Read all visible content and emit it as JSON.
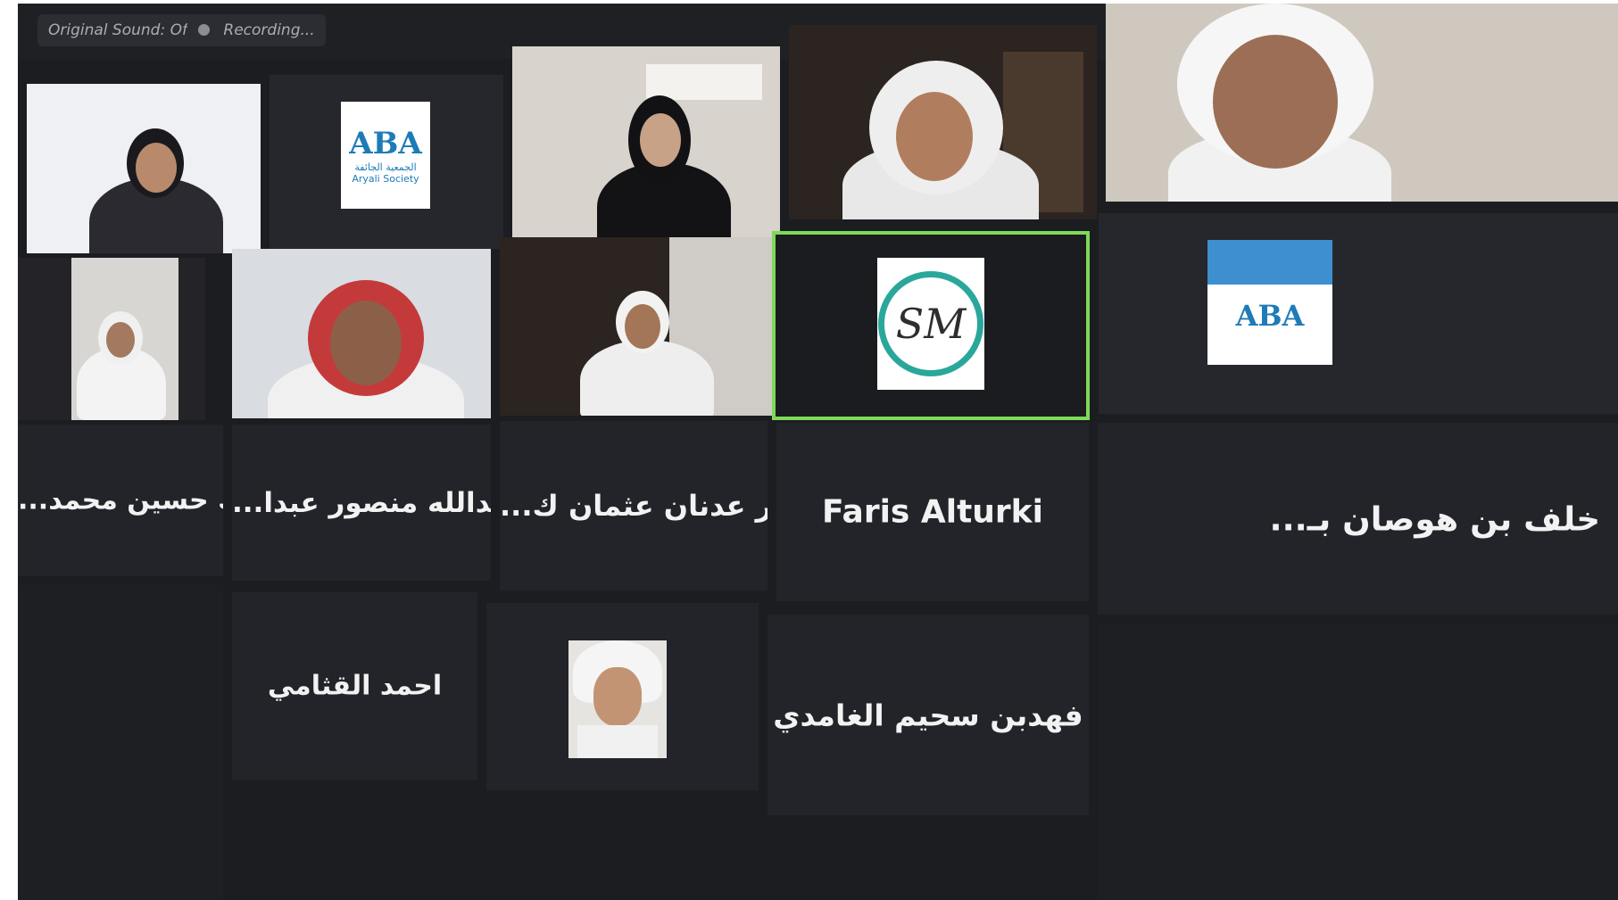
{
  "toolbar": {
    "audio_label": "Original Sound: Off",
    "recording_label": "Recording..."
  },
  "participants": {
    "p1": {
      "name": ""
    },
    "p2": {
      "name": ""
    },
    "p3": {
      "name": ""
    },
    "p4": {
      "name": ""
    },
    "p5": {
      "name": ""
    },
    "p6": {
      "name": ""
    },
    "p7": {
      "name": ""
    },
    "p8": {
      "name": ""
    },
    "p9": {
      "name": "Faris Alturki"
    },
    "p10": {
      "name": ""
    }
  },
  "name_tiles": {
    "t1": "...مبارك حسين محمد",
    "t2": "...عبدالله منصور عبدا",
    "t3": "...بندر عدنان عثمان ك",
    "t4": "Faris Alturki",
    "t5": "...خلف بن هوصان بـ",
    "t6": "احمد القثامي",
    "t8": "فهدبن سحيم الغامدي"
  },
  "logos": {
    "abc_mark": "ABA",
    "abc_sub": "الجمعية الجائفة\nAryali Society",
    "sm_mark": "SM"
  },
  "colors": {
    "active_speaker_border": "#7ed957",
    "screen_background": "#1c1d21",
    "logo_blue": "#1e7bb8",
    "logo_teal": "#2aa79b"
  }
}
